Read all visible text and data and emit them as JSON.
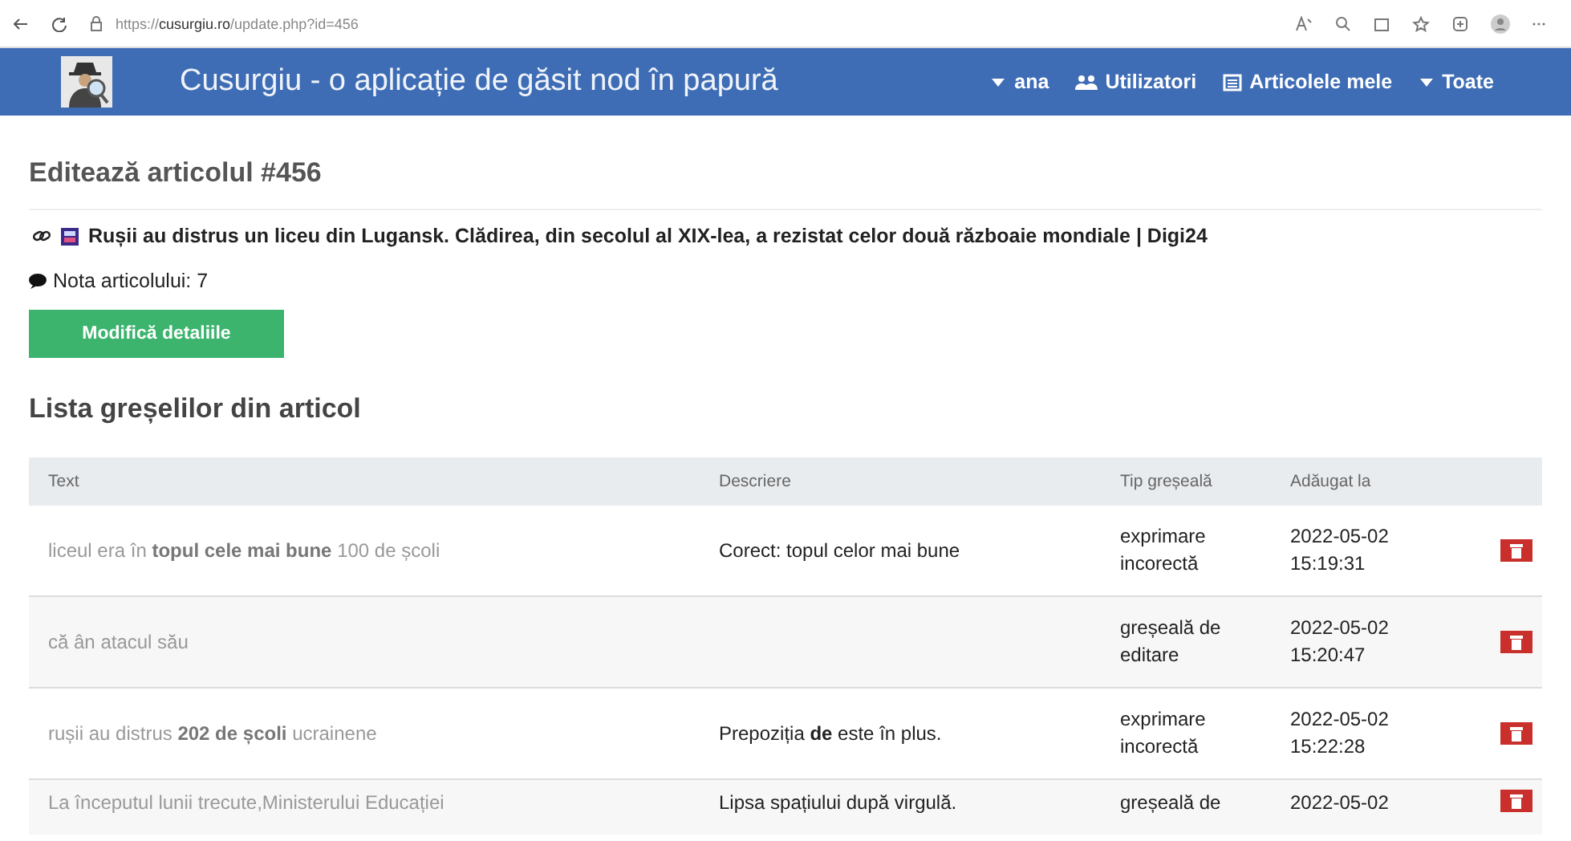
{
  "browser": {
    "url_prefix": "https://",
    "url_domain": "cusurgiu.ro",
    "url_path": "/update.php?id=456"
  },
  "navbar": {
    "title": "Cusurgiu - o aplicație de găsit nod în papură",
    "items": [
      {
        "kind": "dropdown",
        "label": "ana"
      },
      {
        "kind": "users",
        "label": "Utilizatori"
      },
      {
        "kind": "list",
        "label": "Articolele mele"
      },
      {
        "kind": "dropdown",
        "label": "Toate"
      }
    ]
  },
  "article": {
    "heading": "Editează articolul #456",
    "link_title": "Rușii au distrus un liceu din Lugansk. Clădirea, din secolul al XIX-lea, a rezistat celor două războaie mondiale | Digi24",
    "rating": "Nota articolului: 7",
    "edit_button": "Modifică detaliile"
  },
  "errors": {
    "heading": "Lista greșelilor din articol",
    "columns": [
      "Text",
      "Descriere",
      "Tip greșeală",
      "Adăugat la"
    ],
    "rows": [
      {
        "text": "liceul era în **topul cele mai bune** 100 de școli",
        "description": "Corect: topul celor mai bune",
        "type": "exprimare incorectă",
        "added": "2022-05-02 15:19:31"
      },
      {
        "text": "că ân atacul său",
        "description": "",
        "type": "greșeală de editare",
        "added": "2022-05-02 15:20:47"
      },
      {
        "text": "rușii au distrus **202 de școli** ucrainene",
        "description": "Prepoziția **de** este în plus.",
        "type": "exprimare incorectă",
        "added": "2022-05-02 15:22:28"
      },
      {
        "text": "La începutul lunii trecute,Ministerului Educației",
        "description": "Lipsa spațiului după virgulă.",
        "type": "greșeală de",
        "added": "2022-05-02"
      }
    ]
  }
}
